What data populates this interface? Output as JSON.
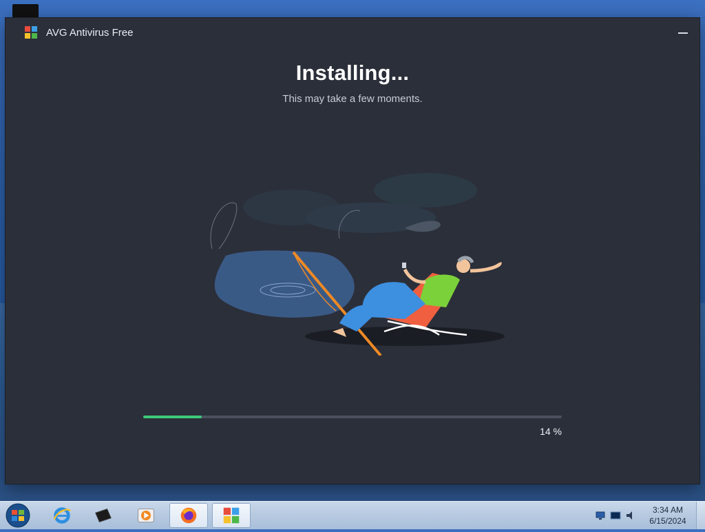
{
  "window": {
    "title": "AVG Antivirus Free"
  },
  "install": {
    "headline": "Installing...",
    "subline": "This may take a few moments.",
    "progress_percent": 14,
    "progress_label": "14 %"
  },
  "taskbar": {
    "items": [
      "start-orb",
      "internet-explorer",
      "terminal",
      "media-player",
      "firefox",
      "avg-installer"
    ],
    "active_item": "avg-installer",
    "clock": {
      "time": "3:34 AM",
      "date": "6/15/2024"
    }
  },
  "colors": {
    "window_bg": "#2b2f3a",
    "progress_fill": "#3ec97a",
    "progress_track": "#4a505d"
  }
}
